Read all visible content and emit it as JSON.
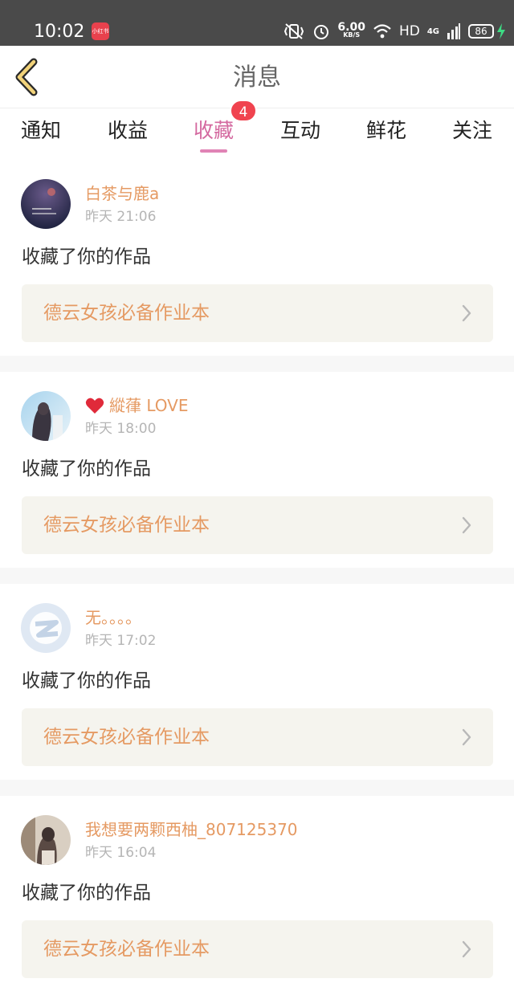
{
  "status_bar": {
    "time": "10:02",
    "app_badge": "小红书",
    "speed_value": "6.00",
    "speed_unit": "KB/S",
    "hd": "HD",
    "network": "4G",
    "battery": "86"
  },
  "header": {
    "title": "消息"
  },
  "tabs": [
    {
      "label": "通知",
      "active": false
    },
    {
      "label": "收益",
      "active": false
    },
    {
      "label": "收藏",
      "active": true,
      "badge": "4"
    },
    {
      "label": "互动",
      "active": false
    },
    {
      "label": "鲜花",
      "active": false
    },
    {
      "label": "关注",
      "active": false
    }
  ],
  "notifications": [
    {
      "name": "白茶与鹿a",
      "time": "昨天 21:06",
      "action": "收藏了你的作品",
      "work": "德云女孩必备作业本",
      "avatar": "dark-night-avatar"
    },
    {
      "name": "縱葎 LOVE",
      "time": "昨天 18:00",
      "action": "收藏了你的作品",
      "work": "德云女孩必备作业本",
      "avatar": "girl-sky-avatar",
      "heart": true
    },
    {
      "name": "无。。。。",
      "time": "昨天 17:02",
      "action": "收藏了你的作品",
      "work": "德云女孩必备作业本",
      "avatar": "default-qq-avatar"
    },
    {
      "name": "我想要两颗西柚_807125370",
      "time": "昨天 16:04",
      "action": "收藏了你的作品",
      "work": "德云女孩必备作业本",
      "avatar": "girl-photo-avatar"
    }
  ],
  "colors": {
    "accent_pink": "#d46aa0",
    "name_orange": "#e59a63",
    "badge_red": "#f0434f"
  }
}
